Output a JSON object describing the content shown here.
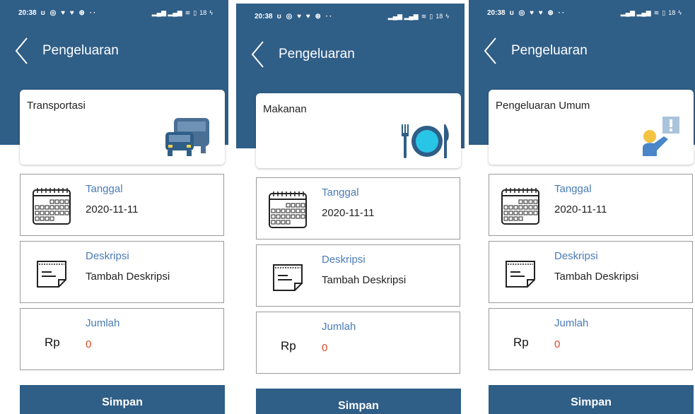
{
  "colors": {
    "header": "#2f5e87",
    "label": "#4a7bb5",
    "amount": "#d9472b"
  },
  "screens": [
    {
      "status": {
        "time": "20:38",
        "notif_icons": "ʊ ◎ ♥ ♥ ⊛ ··",
        "battery": "18"
      },
      "header": {
        "title": "Pengeluaran"
      },
      "category": {
        "label": "Transportasi",
        "icon": "bus-icon"
      },
      "date": {
        "label": "Tanggal",
        "value": "2020-11-11"
      },
      "description": {
        "label": "Deskripsi",
        "value": "Tambah Deskripsi"
      },
      "amount": {
        "label": "Jumlah",
        "currency": "Rp",
        "value": "0"
      },
      "save_label": "Simpan"
    },
    {
      "status": {
        "time": "20:38",
        "notif_icons": "ʊ ◎ ♥ ♥ ⊛ ··",
        "battery": "18"
      },
      "header": {
        "title": "Pengeluaran"
      },
      "category": {
        "label": "Makanan",
        "icon": "plate-cutlery-icon"
      },
      "date": {
        "label": "Tanggal",
        "value": "2020-11-11"
      },
      "description": {
        "label": "Deskripsi",
        "value": "Tambah Deskripsi"
      },
      "amount": {
        "label": "Jumlah",
        "currency": "Rp",
        "value": "0"
      },
      "save_label": "Simpan"
    },
    {
      "status": {
        "time": "20:38",
        "notif_icons": "ʊ ◎ ♥ ♥ ⊛ ··",
        "battery": "18"
      },
      "header": {
        "title": "Pengeluaran"
      },
      "category": {
        "label": "Pengeluaran Umum",
        "icon": "person-alert-icon"
      },
      "date": {
        "label": "Tanggal",
        "value": "2020-11-11"
      },
      "description": {
        "label": "Deskripsi",
        "value": "Tambah Deskripsi"
      },
      "amount": {
        "label": "Jumlah",
        "currency": "Rp",
        "value": "0"
      },
      "save_label": "Simpan"
    }
  ]
}
